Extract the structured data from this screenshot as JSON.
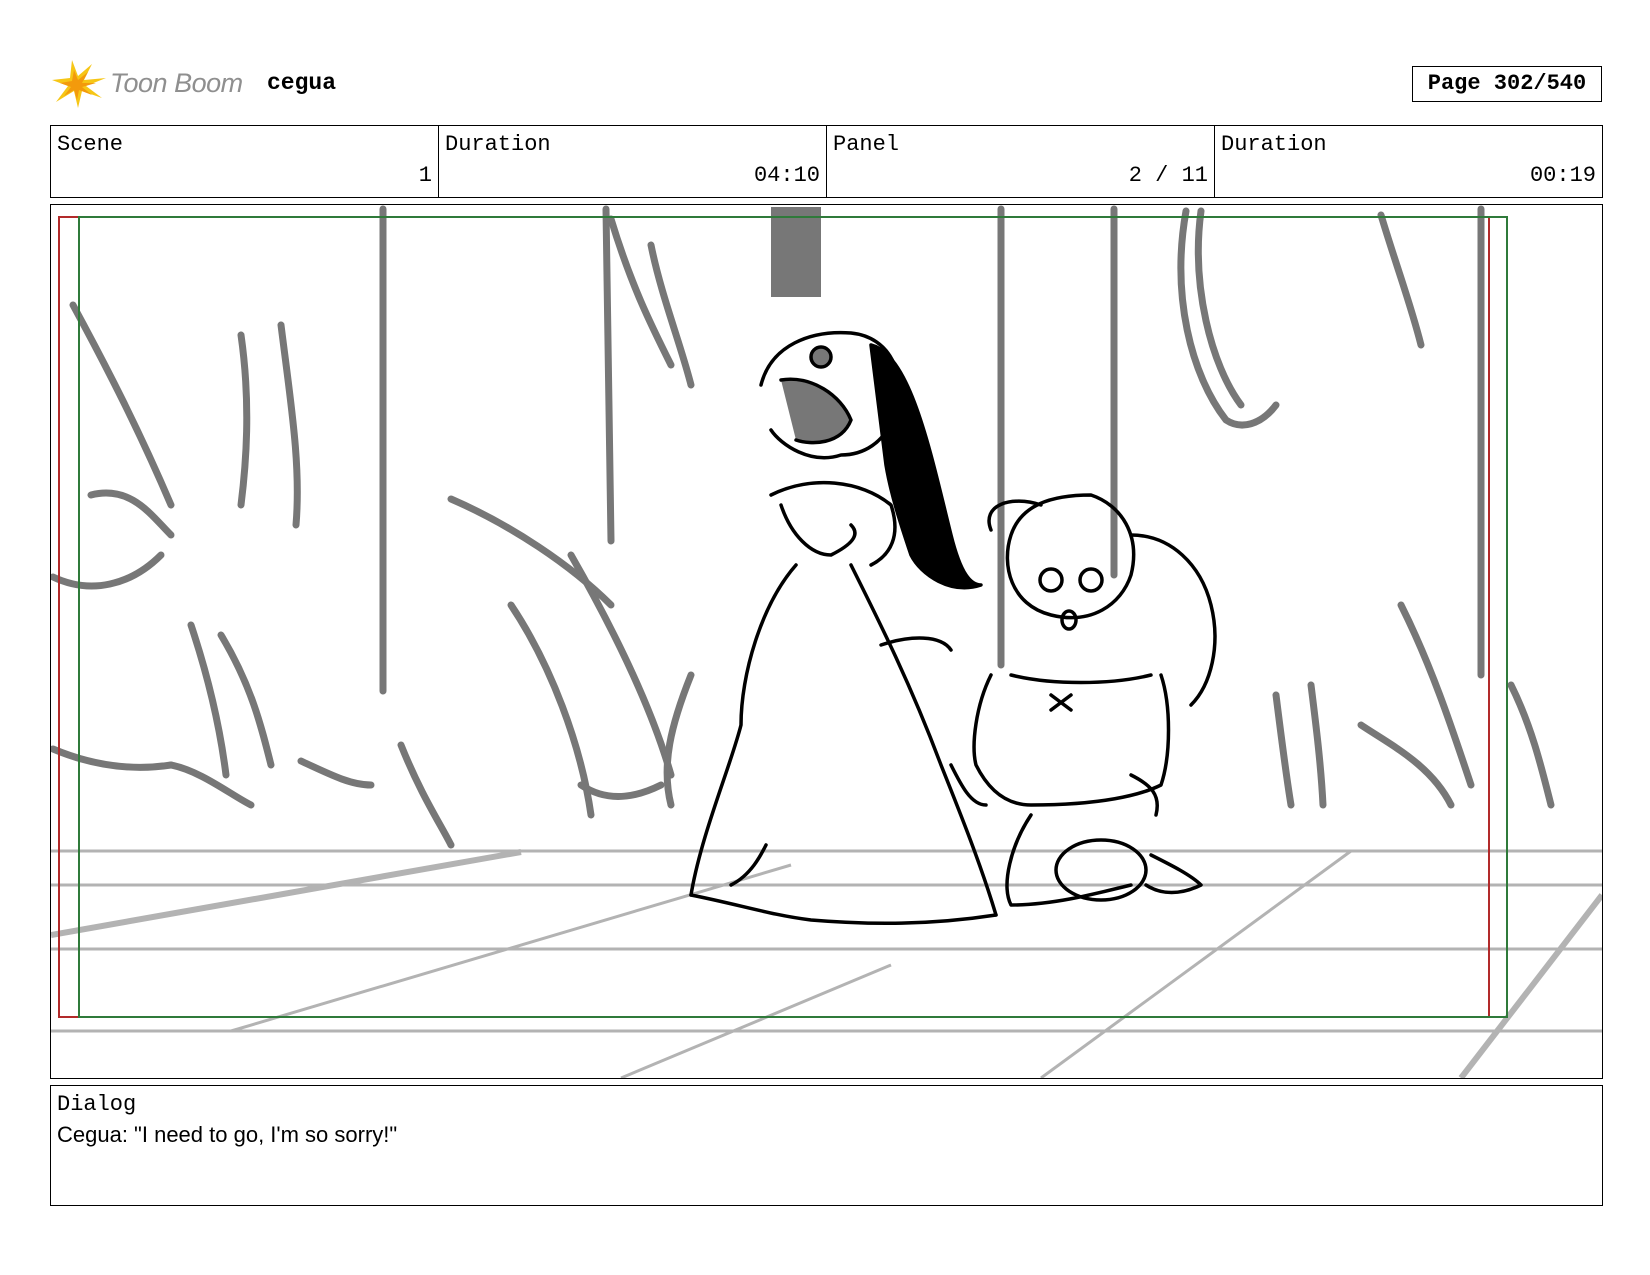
{
  "header": {
    "brand": "Toon Boom",
    "project": "cegua",
    "page": "Page 302/540",
    "logo_icon": "starburst-icon"
  },
  "info": {
    "scene_label": "Scene",
    "scene_value": "1",
    "scene_duration_label": "Duration",
    "scene_duration_value": "04:10",
    "panel_label": "Panel",
    "panel_value": "2 / 11",
    "panel_duration_label": "Duration",
    "panel_duration_value": "00:19"
  },
  "panel": {
    "description": "",
    "safe_frame_color": "#b22a2a",
    "title_safe_color": "#2f7a3a"
  },
  "dialog": {
    "label": "Dialog",
    "text": "Cegua: \"I need to go, I'm so sorry!\""
  }
}
